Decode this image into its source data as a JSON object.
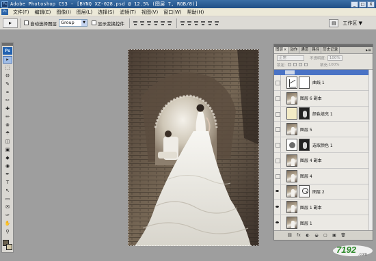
{
  "titlebar": {
    "title": "Adobe Photoshop CS3 - [BYNQ XZ-028.psd @ 12.5% (图层 7, RGB/8)]",
    "app_icon": "Ps",
    "buttons": [
      "_",
      "□",
      "X"
    ]
  },
  "menubar": {
    "items": [
      "文件(F)",
      "编辑(E)",
      "图像(I)",
      "图层(L)",
      "选择(S)",
      "滤镜(T)",
      "视图(V)",
      "窗口(W)",
      "帮助(H)"
    ]
  },
  "optionsbar": {
    "auto_select_label": "自动选择图层",
    "auto_select_value": "Group",
    "show_transform_label": "显示变换控件",
    "workspace_label": "工作区 ▼"
  },
  "toolbox": {
    "logo": "Ps",
    "tools": [
      "move-tool",
      "marquee-tool",
      "lasso-tool",
      "quick-selection-tool",
      "crop-tool",
      "slice-tool",
      "healing-brush-tool",
      "brush-tool",
      "clone-stamp-tool",
      "history-brush-tool",
      "eraser-tool",
      "gradient-tool",
      "blur-tool",
      "dodge-tool",
      "pen-tool",
      "type-tool",
      "path-selection-tool",
      "shape-tool",
      "notes-tool",
      "eyedropper-tool",
      "hand-tool",
      "zoom-tool"
    ],
    "tool_glyphs": [
      "▸",
      "⬚",
      "ʘ",
      "✎",
      "⌗",
      "✂",
      "✚",
      "✏",
      "⊗",
      "☂",
      "◫",
      "▣",
      "◆",
      "◉",
      "✒",
      "T",
      "↖",
      "▭",
      "✉",
      "✑",
      "✋",
      "⚲"
    ],
    "colors": {
      "foreground": "#6b624f",
      "background": "#d2c8a8"
    }
  },
  "layers_panel": {
    "tabs": [
      "图层",
      "动作",
      "通道",
      "路径",
      "历史记录"
    ],
    "tab_close": "×",
    "menu_arrow": "▸≡",
    "blend_mode": "正常",
    "opacity_label": "不透明度:",
    "opacity": "100%",
    "lock_label": "锁定:",
    "fill_label": "填充:",
    "fill": "100%",
    "layers": [
      {
        "name": "曲线 1",
        "visible": false,
        "thumb": "adj-curves",
        "mask": "mask-white"
      },
      {
        "name": "图层 6 副本",
        "visible": false,
        "thumb": "photo",
        "mask": ""
      },
      {
        "name": "颜色填充 1",
        "visible": false,
        "thumb": "fill",
        "mask": "mask-dark"
      },
      {
        "name": "图层 5",
        "visible": false,
        "thumb": "photo",
        "mask": ""
      },
      {
        "name": "选取颜色 1",
        "visible": false,
        "thumb": "adj-sel",
        "mask": "mask-dark"
      },
      {
        "name": "图层 4 副本",
        "visible": false,
        "thumb": "photo",
        "mask": ""
      },
      {
        "name": "图层 4",
        "visible": false,
        "thumb": "photo",
        "mask": ""
      },
      {
        "name": "图层 2",
        "visible": true,
        "thumb": "photo",
        "mask": "mask-icon"
      },
      {
        "name": "图层 1 副本",
        "visible": true,
        "thumb": "photo",
        "mask": ""
      },
      {
        "name": "图层 1",
        "visible": true,
        "thumb": "photo",
        "mask": ""
      },
      {
        "name": "背景",
        "visible": true,
        "thumb": "photo",
        "mask": "",
        "locked": true
      }
    ],
    "footer_buttons": [
      "⛓",
      "fx",
      "◐",
      "◒",
      "▢",
      "▣",
      "🗑"
    ]
  },
  "watermark": {
    "text": "7192",
    "suffix": ".com"
  },
  "colors": {
    "title_bg": "#1f4f86",
    "workspace_bg": "#9e9e9e",
    "selection_blue": "#4a73c5"
  }
}
